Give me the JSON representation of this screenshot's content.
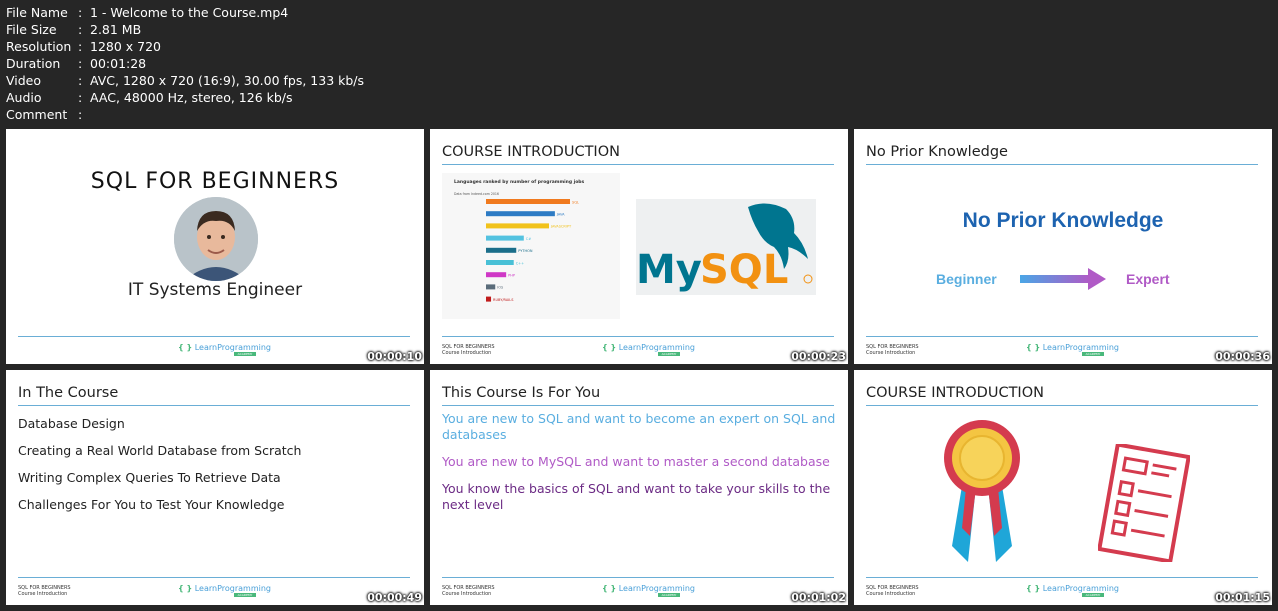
{
  "metadata": [
    {
      "key": "File Name",
      "value": "1 - Welcome to the Course.mp4"
    },
    {
      "key": "File Size",
      "value": "2.81 MB"
    },
    {
      "key": "Resolution",
      "value": "1280 x 720"
    },
    {
      "key": "Duration",
      "value": "00:01:28"
    },
    {
      "key": "Video",
      "value": "AVC, 1280 x 720 (16:9), 30.00 fps, 133 kb/s"
    },
    {
      "key": "Audio",
      "value": "AAC, 48000 Hz, stereo, 126 kb/s"
    },
    {
      "key": "Comment",
      "value": ""
    }
  ],
  "separator": ":",
  "footer": {
    "course": "SQL FOR BEGINNERS",
    "section": "Course Introduction",
    "logo": "LearnProgramming",
    "logo_brace": "{ }",
    "logo_sub": "ACADEMY"
  },
  "thumbs": [
    {
      "timestamp": "00:00:10",
      "title": "SQL FOR BEGINNERS",
      "subtitle": "IT Systems Engineer"
    },
    {
      "timestamp": "00:00:23",
      "title": "COURSE INTRODUCTION",
      "chart_title": "Languages ranked by number of programming jobs",
      "chart_note": "Data from Indeed.com 2016",
      "bars": [
        {
          "label": "SQL",
          "value": 100,
          "color": "#f07a1e"
        },
        {
          "label": "JAVA",
          "value": 82,
          "color": "#2d7bc4"
        },
        {
          "label": "JAVASCRIPT",
          "value": 75,
          "color": "#f1c21b"
        },
        {
          "label": "C#",
          "value": 45,
          "color": "#53c2e0"
        },
        {
          "label": "PYTHON",
          "value": 36,
          "color": "#1b6e8a"
        },
        {
          "label": "C++",
          "value": 33,
          "color": "#48c0d6"
        },
        {
          "label": "PHP",
          "value": 24,
          "color": "#cf38c6"
        },
        {
          "label": "IOS",
          "value": 11,
          "color": "#5a6c7a"
        },
        {
          "label": "RUBY/RAILS",
          "value": 6,
          "color": "#c01b1b"
        }
      ],
      "logo_text": "MySQL"
    },
    {
      "timestamp": "00:00:36",
      "title": "No Prior Knowledge",
      "headline": "No Prior Knowledge",
      "from": "Beginner",
      "to": "Expert"
    },
    {
      "timestamp": "00:00:49",
      "title": "In The Course",
      "items": [
        "Database Design",
        "Creating a Real World Database from Scratch",
        "Writing Complex Queries To Retrieve Data",
        "Challenges For You to Test Your Knowledge"
      ]
    },
    {
      "timestamp": "00:01:02",
      "title": "This Course Is For You",
      "items": [
        "You are new to SQL and want to become an expert on SQL and databases",
        "You are new to MySQL and want to master a second database",
        "You know the basics of SQL and want to take your skills to the next level"
      ]
    },
    {
      "timestamp": "00:01:15",
      "title": "COURSE INTRODUCTION"
    }
  ],
  "colors": {
    "bg": "#262626",
    "accent_blue": "#1d63b0",
    "light_blue": "#5aaee0",
    "magenta": "#b05ac6",
    "purple": "#6b2a84",
    "mysql_blue": "#00758f",
    "mysql_orange": "#f29111"
  }
}
